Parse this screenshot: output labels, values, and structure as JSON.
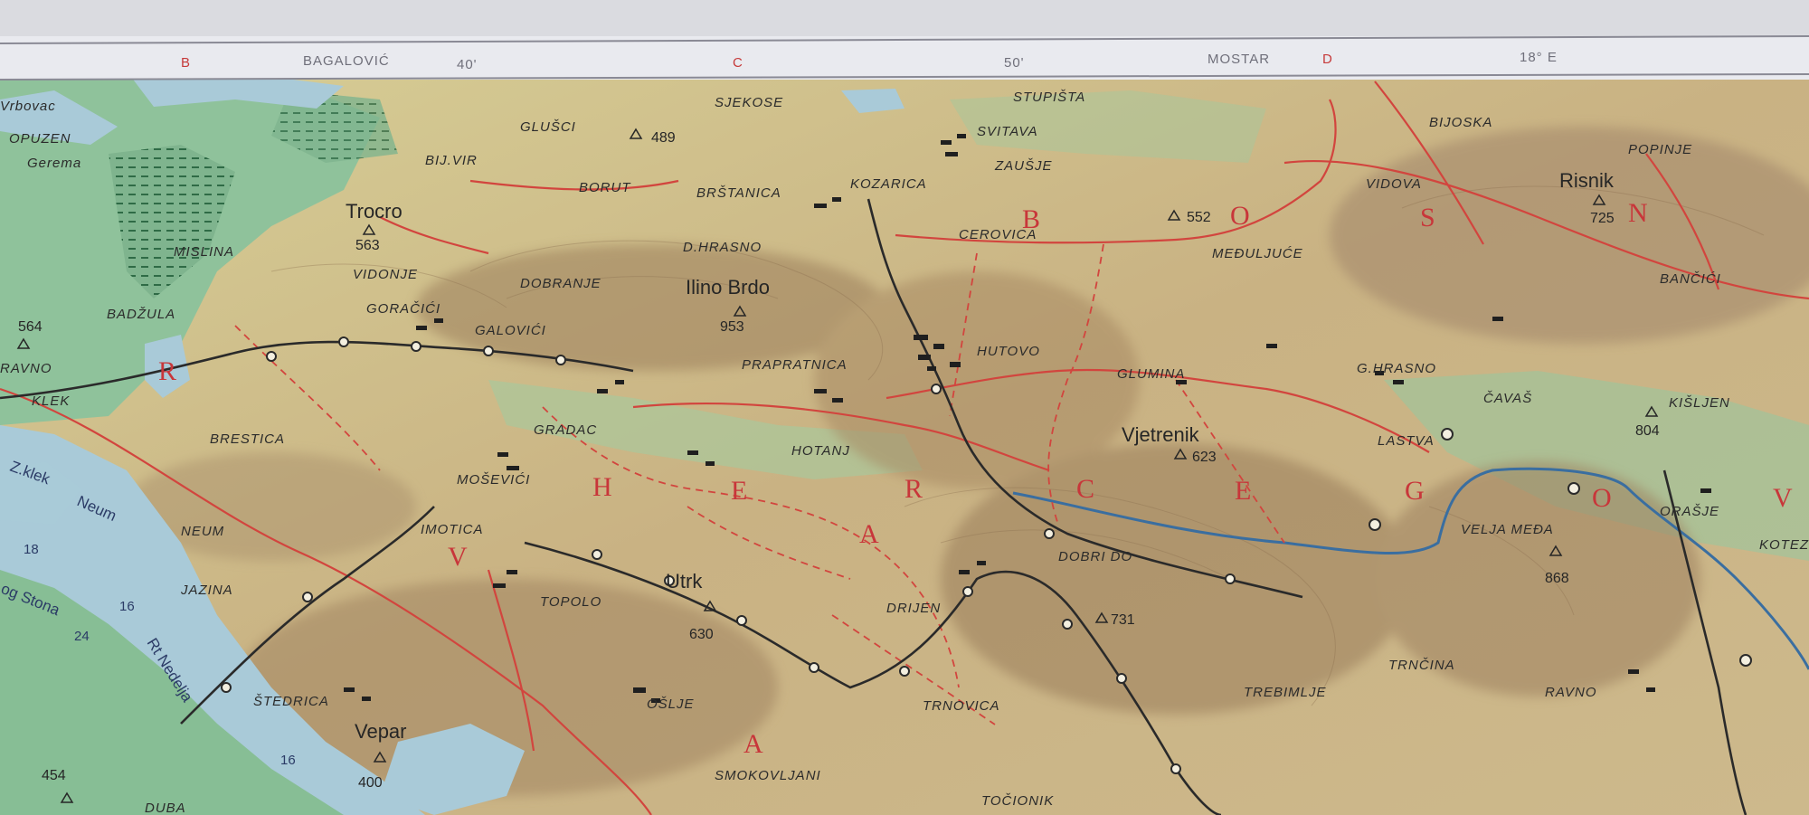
{
  "border_ticks": [
    {
      "label": "B",
      "color": "red"
    },
    {
      "label": "BAGALOVIĆ",
      "color": "grey"
    },
    {
      "label": "40'",
      "color": "grey"
    },
    {
      "label": "C",
      "color": "red"
    },
    {
      "label": "50'",
      "color": "grey"
    },
    {
      "label": "MOSTAR",
      "color": "grey"
    },
    {
      "label": "D",
      "color": "red"
    },
    {
      "label": "18° E",
      "color": "grey"
    }
  ],
  "places": [
    "OPUZEN",
    "GLUŠCI",
    "SJEKOSE",
    "STUPIŠTA",
    "SVITAVA",
    "ZAUŠJE",
    "BIJOSKA",
    "POPINJE",
    "BIJ.VIR",
    "BORUT",
    "BRŠTANICA",
    "KOZARICA",
    "VIDOVA",
    "CEROVICA",
    "MEĐULJUĆE",
    "D.HRASNO",
    "VIDONJE",
    "DOBRANJE",
    "GORAČIĆI",
    "GALOVIĆI",
    "BADŽULA",
    "RAVNO",
    "KLEK",
    "HUTOVO",
    "GLUMINA",
    "G.HRASNO",
    "ČAVAŠ",
    "KIŠLJEN",
    "BANČIĆI",
    "PRAPRATNICA",
    "BRESTICA",
    "GRADAC",
    "HOTANJ",
    "LASTVA",
    "MOŠEVIĆI",
    "NEUM",
    "IMOTICA",
    "DOBRI DO",
    "VELJA MEĐA",
    "ORAŠJE",
    "KOTEZ",
    "JAZINA",
    "TOPOLO",
    "DRIJEN",
    "TRNČINA",
    "TREBIMLJE",
    "RAVNO",
    "ŠTEDRICA",
    "OŠLJE",
    "TRNOVICA",
    "SMOKOVLJANI",
    "TOČIONIK",
    "DUBA",
    "MISLINA",
    "Vrbovac",
    "Gerema"
  ],
  "peaks": [
    {
      "name": "Trocro",
      "elevation": "563"
    },
    {
      "name": "Ilino Brdo",
      "elevation": "953"
    },
    {
      "name": "Vjetrenik",
      "elevation": "623"
    },
    {
      "name": "Risnik",
      "elevation": "725"
    },
    {
      "name": "Utrk",
      "elevation": "630"
    },
    {
      "name": "Vepar",
      "elevation": "400"
    },
    {
      "name": "",
      "elevation": "564"
    },
    {
      "name": "",
      "elevation": "489"
    },
    {
      "name": "",
      "elevation": "552"
    },
    {
      "name": "",
      "elevation": "804"
    },
    {
      "name": "",
      "elevation": "868"
    },
    {
      "name": "",
      "elevation": "731"
    },
    {
      "name": "",
      "elevation": "454"
    }
  ],
  "region_letters": [
    "H",
    "E",
    "R",
    "C",
    "E",
    "G",
    "O",
    "V",
    "B",
    "A",
    "R",
    "O",
    "S",
    "N",
    "V",
    "A"
  ],
  "water_labels": [
    "Z.klek",
    "Neum",
    "Rt Nedelja",
    "og Stona"
  ],
  "water_numbers": [
    "16",
    "24",
    "16",
    "18"
  ],
  "colors": {
    "lowland_green": "#7bb98d",
    "upland": "#e6d9a2",
    "highland": "#b59a70",
    "sea": "#a9cad8",
    "road": "#d2453e",
    "rail": "#2a2a2a",
    "river": "#3a6ea0",
    "region_text": "#c8363a"
  }
}
